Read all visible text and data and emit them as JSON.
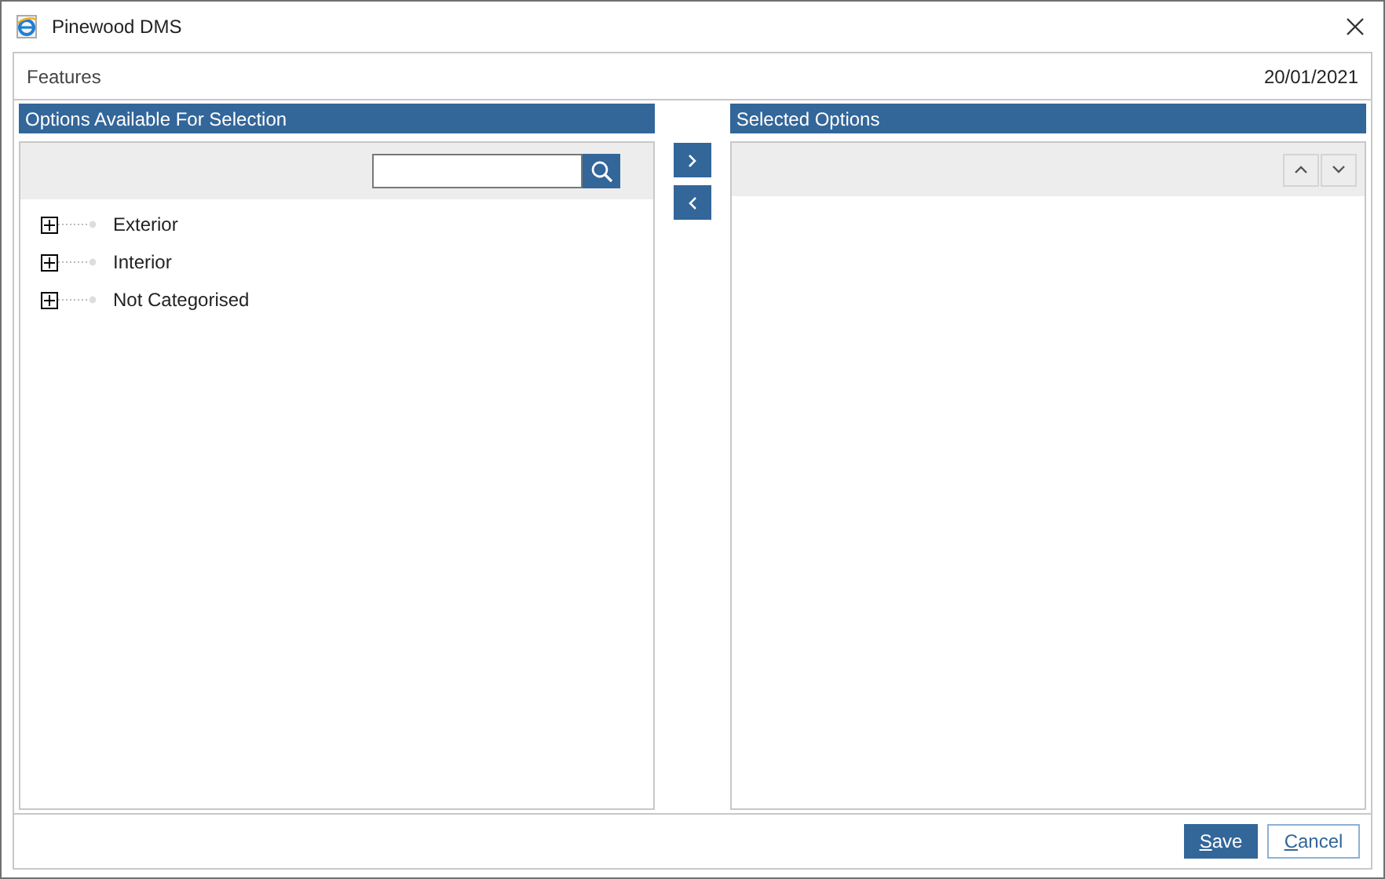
{
  "window": {
    "title": "Pinewood DMS"
  },
  "header": {
    "title": "Features",
    "date": "20/01/2021"
  },
  "available": {
    "title": "Options Available For Selection",
    "tree": [
      {
        "label": "Exterior",
        "expanded": false
      },
      {
        "label": "Interior",
        "expanded": false
      },
      {
        "label": "Not Categorised",
        "expanded": false
      }
    ]
  },
  "selected": {
    "title": "Selected Options"
  },
  "buttons": [
    {
      "label": "Save",
      "kind": "primary",
      "mnemonic": true
    },
    {
      "label": "Cancel",
      "kind": "secondary",
      "mnemonic": true
    }
  ]
}
